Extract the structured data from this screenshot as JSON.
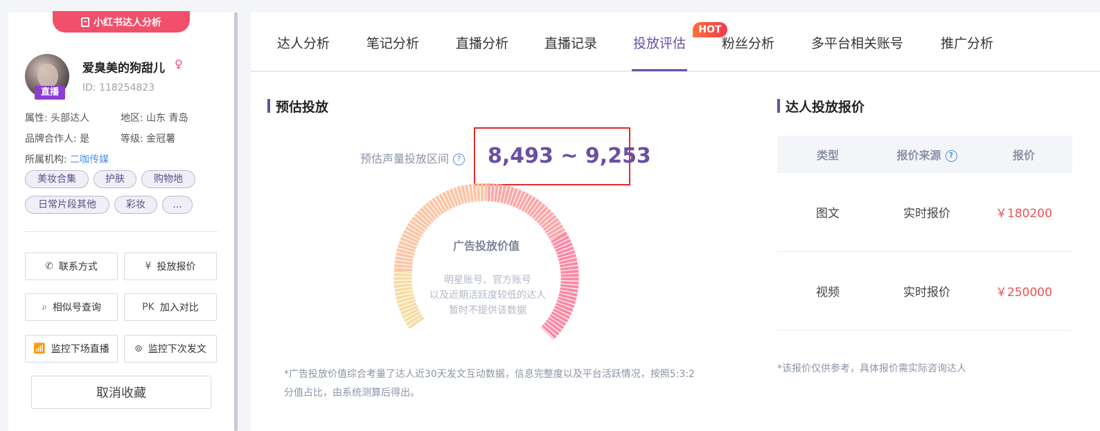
{
  "sidebar": {
    "banner": "小红书达人分析",
    "avatar_badge": "直播",
    "nickname": "爱臭美的狗甜儿",
    "id_text": "ID:  118254823",
    "attr_label": "属性: ",
    "attr_value": "头部达人",
    "region_label": "地区: ",
    "region_value": "山东 青岛",
    "brand_label": "品牌合作人: ",
    "brand_value": "是",
    "level_label": "等级: ",
    "level_value": "金冠薯",
    "org_label": "所属机构: ",
    "org_value": "二咖传媒",
    "tags": [
      "美妆合集",
      "护肤",
      "购物地",
      "日常片段其他",
      "彩妆",
      "..."
    ],
    "buttons": {
      "contact": "联系方式",
      "quote": "投放报价",
      "similar": "相似号查询",
      "pk_icon": "PK",
      "compare": "加入对比",
      "monitor_live": "监控下场直播",
      "monitor_post": "监控下次发文",
      "uncollect": "取消收藏"
    }
  },
  "tabs": [
    {
      "label": "达人分析"
    },
    {
      "label": "笔记分析"
    },
    {
      "label": "直播分析"
    },
    {
      "label": "直播记录"
    },
    {
      "label": "投放评估"
    },
    {
      "label": "粉丝分析"
    },
    {
      "label": "多平台相关账号"
    },
    {
      "label": "推广分析"
    }
  ],
  "hot_badge": "HOT",
  "estimate": {
    "title": "预估投放",
    "range_label": "预估声量投放区间",
    "range_value": "8,493 ~ 9,253",
    "gauge_title": "广告投放价值",
    "gauge_msg_1": "明星账号、官方账号",
    "gauge_msg_2": "以及近期活跃度较低的达人",
    "gauge_msg_3": "暂时不提供该数据",
    "note": "*广告投放价值综合考量了达人近30天发文互动数据，信息完整度以及平台活跃情况，按照5:3:2分值占比，由系统测算后得出。"
  },
  "pricing": {
    "title": "达人投放报价",
    "headers": {
      "type": "类型",
      "source": "报价来源",
      "price": "报价"
    },
    "rows": [
      {
        "type": "图文",
        "source": "实时报价",
        "price": "￥180200"
      },
      {
        "type": "视频",
        "source": "实时报价",
        "price": "￥250000"
      }
    ],
    "note": "*该报价仅供参考，具体报价需实际咨询达人"
  },
  "colors": {
    "accent": "#6a4fa3",
    "brand": "#f24f6a",
    "highlight_box": "#e22a2a",
    "price": "#f24f4f",
    "gauge": [
      "#f7dca3",
      "#fcc6a6",
      "#fca8a8",
      "#fc8aa4"
    ]
  }
}
